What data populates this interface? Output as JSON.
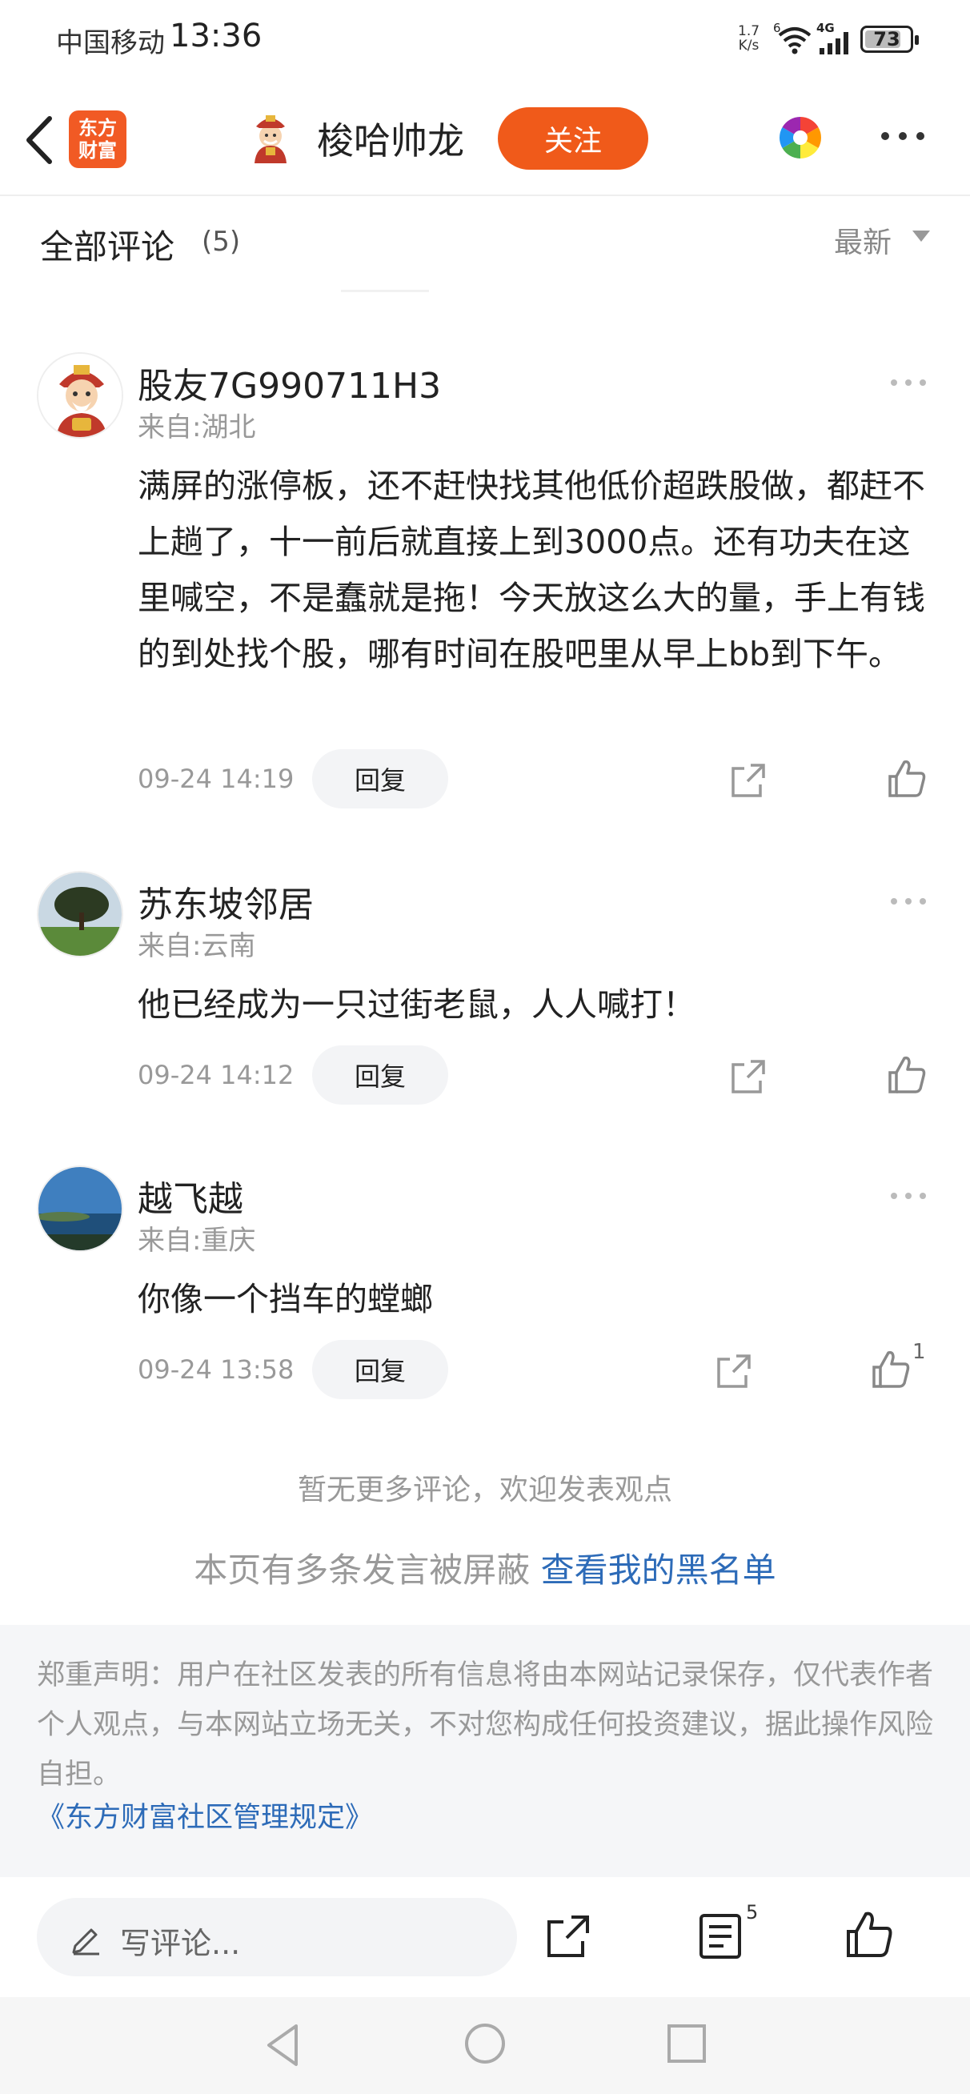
{
  "status_bar": {
    "carrier": "中国移动",
    "time": "13:36",
    "net_speed_value": "1.7",
    "net_speed_unit": "K/s",
    "network_type": "4G",
    "wifi_badge": "6",
    "battery": "73",
    "battery_level": 0.73
  },
  "header": {
    "brand_logo_line1": "东方",
    "brand_logo_line2": "财富",
    "author_name": "梭哈帅龙",
    "follow_label": "关注",
    "accent_color": "#f05a1a"
  },
  "comments_section": {
    "title": "全部评论",
    "count": "(5)",
    "sort_label": "最新"
  },
  "comments": [
    {
      "name": "股友7G990711H3",
      "location": "来自:湖北",
      "body": "满屏的涨停板，还不赶快找其他低价超跌股做，都赶不上趟了，十一前后就直接上到3000点。还有功夫在这里喊空，不是蠢就是拖！今天放这么大的量，手上有钱的到处找个股，哪有时间在股吧里从早上bb到下午。",
      "time": "09-24 14:19",
      "reply_label": "回复",
      "avatar": "fortune-god-avatar",
      "likes": ""
    },
    {
      "name": "苏东坡邻居",
      "location": "来自:云南",
      "body": "他已经成为一只过街老鼠，人人喊打！",
      "time": "09-24 14:12",
      "reply_label": "回复",
      "avatar": "tree-landscape-avatar",
      "likes": ""
    },
    {
      "name": "越飞越",
      "location": "来自:重庆",
      "body": "你像一个挡车的螳螂",
      "time": "09-24 13:58",
      "reply_label": "回复",
      "avatar": "sea-horizon-avatar",
      "likes": "1"
    }
  ],
  "footer_notes": {
    "no_more": "暂无更多评论，欢迎发表观点",
    "blocked_prefix": "本页有多条发言被屏蔽",
    "blocked_link": "查看我的黑名单"
  },
  "disclaimer": {
    "text": "郑重声明：用户在社区发表的所有信息将由本网站记录保存，仅代表作者个人观点，与本网站立场无关，不对您构成任何投资建议，据此操作风险自担。",
    "link": "《东方财富社区管理规定》"
  },
  "bottom_bar": {
    "comment_placeholder": "写评论...",
    "comment_count": "5"
  }
}
